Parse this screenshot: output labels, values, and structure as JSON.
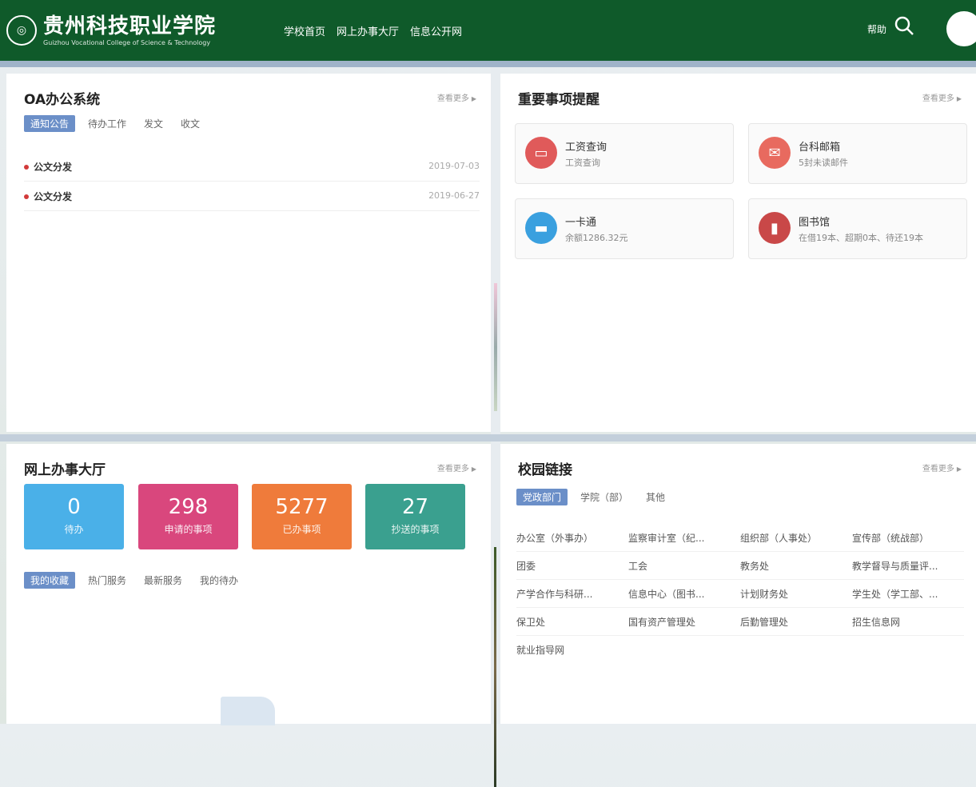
{
  "header": {
    "logo_text_cn": "贵州科技职业学院",
    "logo_text_en": "Guizhou Vocational College of Science & Technology",
    "nav": [
      "学校首页",
      "网上办事大厅",
      "信息公开网"
    ],
    "help": "帮助",
    "colors": {
      "header_bg": "#0f5a2a",
      "accent": "#6b8fc8"
    }
  },
  "oa": {
    "title": "OA办公系统",
    "more": "查看更多",
    "tabs": [
      "通知公告",
      "待办工作",
      "发文",
      "收文"
    ],
    "items": [
      {
        "title": "公文分发",
        "date": "2019-07-03"
      },
      {
        "title": "公文分发",
        "date": "2019-06-27"
      }
    ]
  },
  "alerts": {
    "title": "重要事项提醒",
    "more": "查看更多",
    "cards": [
      {
        "name": "工资查询",
        "sub": "工资查询",
        "icon": "monitor-icon",
        "color": "#e05a5a"
      },
      {
        "name": "台科邮箱",
        "sub": "5封未读邮件",
        "icon": "mail-icon",
        "color": "#e86a5f"
      },
      {
        "name": "一卡通",
        "sub": "余额1286.32元",
        "icon": "card-icon",
        "color": "#3aa0df"
      },
      {
        "name": "图书馆",
        "sub": "在借19本、超期0本、待还19本",
        "icon": "book-icon",
        "color": "#c94848"
      }
    ]
  },
  "hall": {
    "title": "网上办事大厅",
    "more": "查看更多",
    "stats": [
      {
        "value": "0",
        "label": "待办",
        "color": "#4ab0e8"
      },
      {
        "value": "298",
        "label": "申请的事项",
        "color": "#d9477d"
      },
      {
        "value": "5277",
        "label": "已办事项",
        "color": "#ef7b3b"
      },
      {
        "value": "27",
        "label": "抄送的事项",
        "color": "#3aa08f"
      }
    ],
    "tabs": [
      "我的收藏",
      "热门服务",
      "最新服务",
      "我的待办"
    ]
  },
  "links": {
    "title": "校园链接",
    "more": "查看更多",
    "tabs": [
      "党政部门",
      "学院（部）",
      "其他"
    ],
    "rows": [
      [
        "办公室（外事办）",
        "监察审计室（纪...",
        "组织部（人事处）",
        "宣传部（统战部）"
      ],
      [
        "团委",
        "工会",
        "教务处",
        "教学督导与质量评..."
      ],
      [
        "产学合作与科研...",
        "信息中心（图书...",
        "计划财务处",
        "学生处（学工部、..."
      ],
      [
        "保卫处",
        "国有资产管理处",
        "后勤管理处",
        "招生信息网"
      ],
      [
        "就业指导网"
      ]
    ]
  }
}
